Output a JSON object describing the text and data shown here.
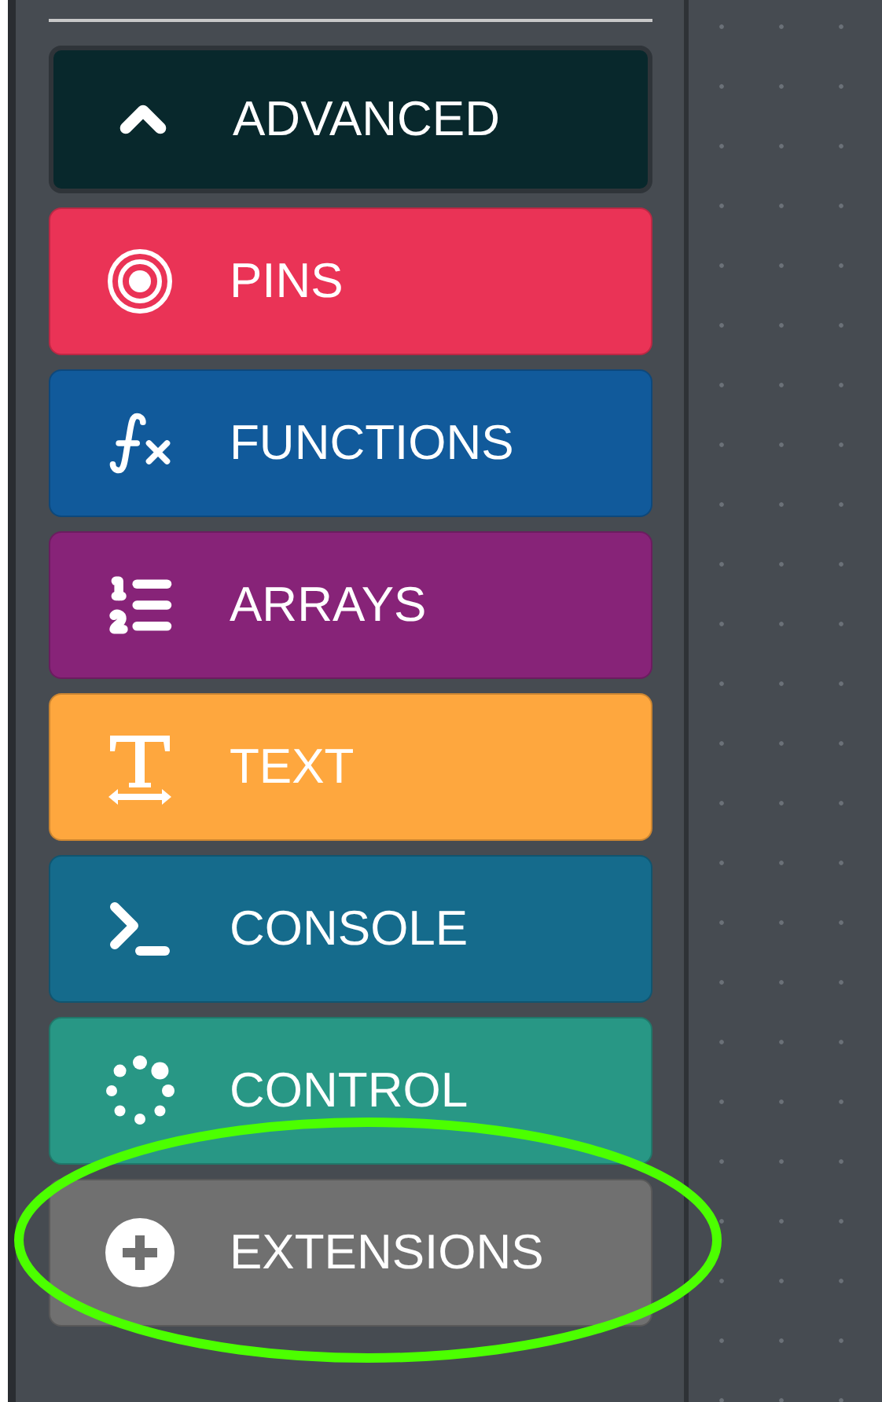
{
  "categories": [
    {
      "label": "ADVANCED",
      "kind": "chevron",
      "color": "#08282c",
      "highlighted": false
    },
    {
      "label": "PINS",
      "kind": "target",
      "color": "#ea3356",
      "highlighted": false
    },
    {
      "label": "FUNCTIONS",
      "kind": "function",
      "color": "#115a9b",
      "highlighted": false
    },
    {
      "label": "ARRAYS",
      "kind": "list",
      "color": "#872378",
      "highlighted": false
    },
    {
      "label": "TEXT",
      "kind": "text",
      "color": "#fea73e",
      "highlighted": false
    },
    {
      "label": "CONSOLE",
      "kind": "terminal",
      "color": "#156b8c",
      "highlighted": false
    },
    {
      "label": "CONTROL",
      "kind": "loop",
      "color": "#289785",
      "highlighted": false
    },
    {
      "label": "EXTENSIONS",
      "kind": "plus",
      "color": "#707070",
      "highlighted": true
    }
  ]
}
